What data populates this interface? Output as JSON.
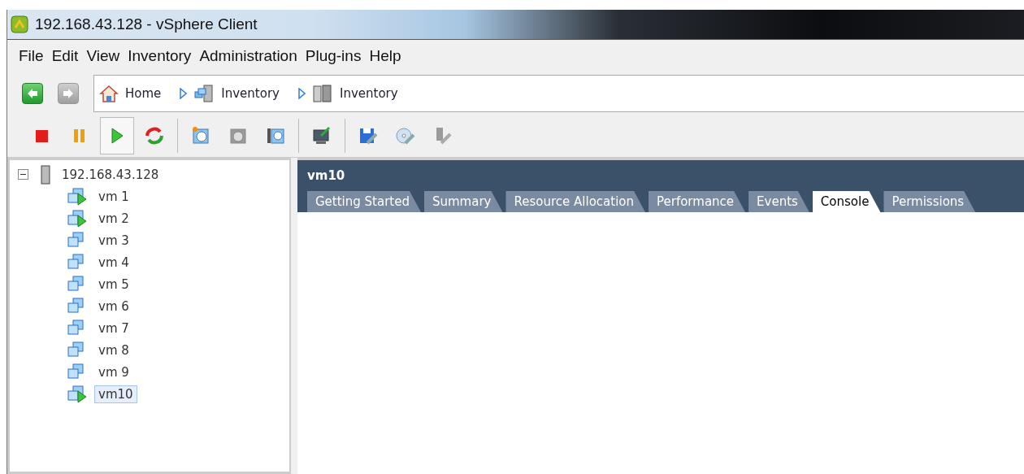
{
  "window": {
    "title": "192.168.43.128 - vSphere Client"
  },
  "menu": [
    "File",
    "Edit",
    "View",
    "Inventory",
    "Administration",
    "Plug-ins",
    "Help"
  ],
  "nav": {
    "back_disabled": false,
    "forward_disabled": true,
    "breadcrumb": [
      {
        "kind": "home",
        "label": "Home"
      },
      {
        "kind": "hosts",
        "label": "Inventory"
      },
      {
        "kind": "servers",
        "label": "Inventory"
      }
    ]
  },
  "toolbar": [
    {
      "kind": "stop",
      "disabled": false,
      "pressed": false
    },
    {
      "kind": "pause",
      "disabled": false,
      "pressed": false
    },
    {
      "kind": "play",
      "disabled": false,
      "pressed": true
    },
    {
      "kind": "reset",
      "disabled": false,
      "pressed": false
    },
    {
      "kind": "separator"
    },
    {
      "kind": "snapshot",
      "disabled": false,
      "pressed": false
    },
    {
      "kind": "revert",
      "disabled": true,
      "pressed": false
    },
    {
      "kind": "manager",
      "disabled": false,
      "pressed": false
    },
    {
      "kind": "separator"
    },
    {
      "kind": "console",
      "disabled": false,
      "pressed": false
    },
    {
      "kind": "separator"
    },
    {
      "kind": "settings",
      "disabled": false,
      "pressed": false
    },
    {
      "kind": "cd",
      "disabled": false,
      "pressed": false
    },
    {
      "kind": "usb",
      "disabled": true,
      "pressed": false
    }
  ],
  "tree": {
    "label": "192.168.43.128",
    "expanded": true,
    "children": [
      {
        "label": "vm 1",
        "running": true,
        "selected": false
      },
      {
        "label": "vm 2",
        "running": true,
        "selected": false
      },
      {
        "label": "vm 3",
        "running": false,
        "selected": false
      },
      {
        "label": "vm 4",
        "running": false,
        "selected": false
      },
      {
        "label": "vm 5",
        "running": false,
        "selected": false
      },
      {
        "label": "vm 6",
        "running": false,
        "selected": false
      },
      {
        "label": "vm 7",
        "running": false,
        "selected": false
      },
      {
        "label": "vm 8",
        "running": false,
        "selected": false
      },
      {
        "label": "vm 9",
        "running": false,
        "selected": false
      },
      {
        "label": "vm10",
        "running": true,
        "selected": true
      }
    ]
  },
  "detail": {
    "title": "vm10",
    "tabs": [
      {
        "label": "Getting Started",
        "selected": false
      },
      {
        "label": "Summary",
        "selected": false
      },
      {
        "label": "Resource Allocation",
        "selected": false
      },
      {
        "label": "Performance",
        "selected": false
      },
      {
        "label": "Events",
        "selected": false
      },
      {
        "label": "Console",
        "selected": true
      },
      {
        "label": "Permissions",
        "selected": false
      }
    ]
  }
}
